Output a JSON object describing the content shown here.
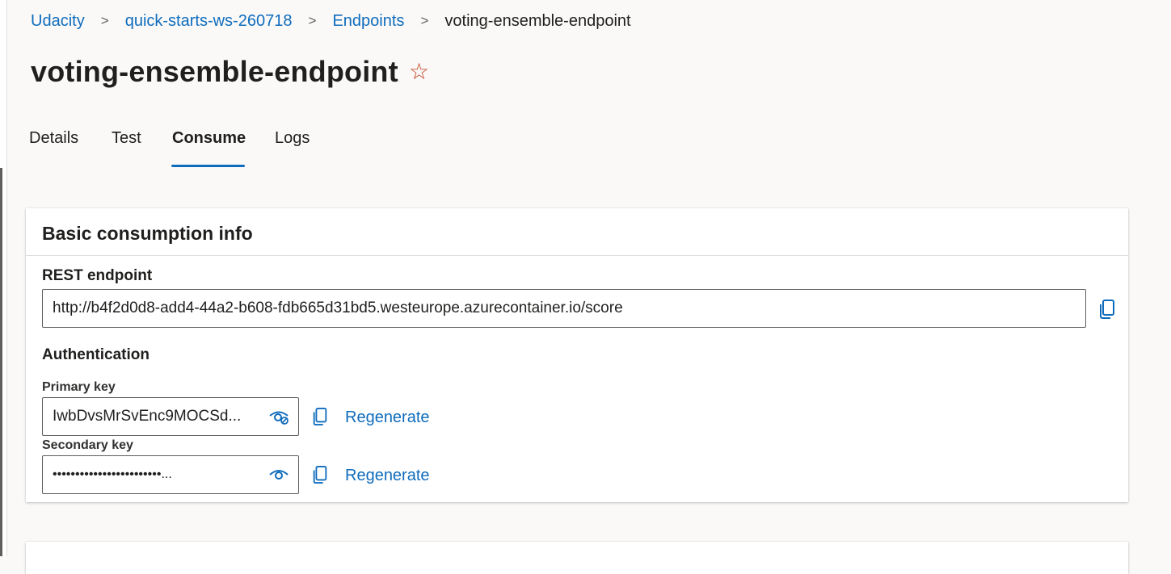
{
  "breadcrumb": {
    "items": [
      "Udacity",
      "quick-starts-ws-260718",
      "Endpoints"
    ],
    "current": "voting-ensemble-endpoint",
    "separator": ">"
  },
  "page": {
    "title": "voting-ensemble-endpoint",
    "favorite_icon": "star-outline-icon"
  },
  "tabs": [
    {
      "label": "Details",
      "active": false
    },
    {
      "label": "Test",
      "active": false
    },
    {
      "label": "Consume",
      "active": true
    },
    {
      "label": "Logs",
      "active": false
    }
  ],
  "consumption": {
    "title": "Basic consumption info",
    "rest_label": "REST endpoint",
    "rest_url": "http://b4f2d0d8-add4-44a2-b608-fdb665d31bd5.westeurope.azurecontainer.io/score",
    "auth_label": "Authentication",
    "primary_label": "Primary key",
    "primary_value": "IwbDvsMrSvEnc9MOCSd...",
    "secondary_label": "Secondary key",
    "secondary_value": "••••••••••••••••••••••••...",
    "regenerate_label": "Regenerate",
    "icons": {
      "copy": "copy-icon",
      "hide": "eye-hide-icon",
      "show": "eye-icon"
    }
  },
  "colors": {
    "accent": "#0f6cbd",
    "star": "#c43e1c"
  }
}
